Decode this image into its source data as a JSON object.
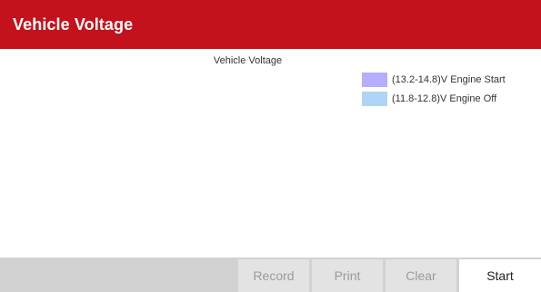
{
  "header": {
    "title": "Vehicle Voltage",
    "color": "#c3121c"
  },
  "chart": {
    "title": "Vehicle Voltage",
    "legend": [
      {
        "label": "(13.2-14.8)V  Engine Start",
        "color": "#b4aefc"
      },
      {
        "label": "(11.8-12.8)V  Engine Off",
        "color": "#b0d4f6"
      }
    ]
  },
  "toolbar": {
    "record_label": "Record",
    "print_label": "Print",
    "clear_label": "Clear",
    "start_label": "Start"
  }
}
